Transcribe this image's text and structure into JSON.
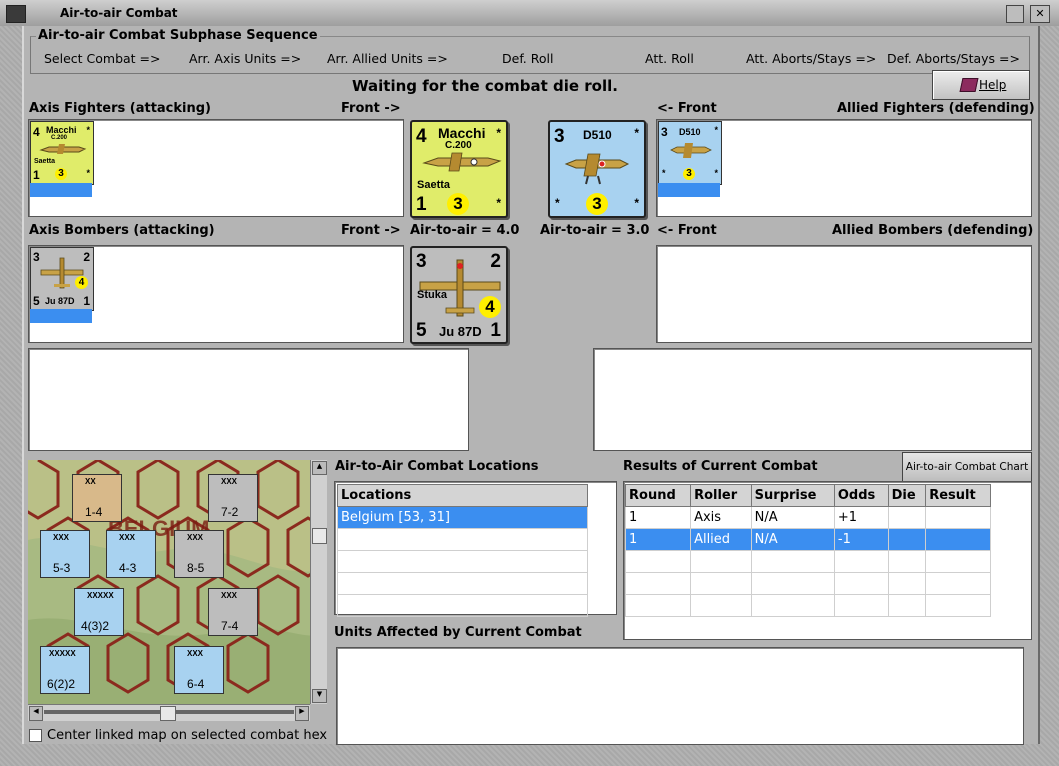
{
  "window": {
    "title": "Air-to-air Combat"
  },
  "sequence": {
    "title": "Air-to-air Combat Subphase Sequence",
    "steps": [
      "Select Combat =>",
      "Arr. Axis Units =>",
      "Arr. Allied Units =>",
      "Def. Roll",
      "Att. Roll",
      "Att. Aborts/Stays =>",
      "Def. Aborts/Stays =>"
    ]
  },
  "status": "Waiting for the combat die roll.",
  "help_label": "Help",
  "labels": {
    "axis_fighters": "Axis Fighters (attacking)",
    "front_right": "Front ->",
    "front_left": "<- Front",
    "allied_fighters": "Allied Fighters (defending)",
    "axis_bombers": "Axis Bombers (attacking)",
    "axis_a2a": "Air-to-air = 4.0",
    "allied_a2a": "Air-to-air = 3.0",
    "allied_bombers": "Allied Bombers (defending)"
  },
  "counters": {
    "macchi": {
      "att": "4",
      "name": "Macchi",
      "model": "C.200",
      "nick": "Saetta",
      "range": "1",
      "def": "3",
      "star": "*",
      "color": "#e0ec6a"
    },
    "d510": {
      "att": "3",
      "name": "D510",
      "range": "*",
      "def": "3",
      "star": "*",
      "color": "#a8d2f0"
    },
    "stuka": {
      "att": "3",
      "top": "2",
      "nick": "Stuka",
      "name": "Ju 87D",
      "range": "5",
      "def": "4",
      "bottom": "1",
      "color": "#bdbdbd"
    }
  },
  "locations": {
    "title": "Air-to-Air Combat Locations",
    "header": "Locations",
    "rows": [
      "Belgium [53, 31]"
    ]
  },
  "results": {
    "title": "Results of Current Combat",
    "chart_button": "Air-to-air Combat Chart",
    "headers": [
      "Round",
      "Roller",
      "Surprise",
      "Odds",
      "Die",
      "Result"
    ],
    "rows": [
      [
        "1",
        "Axis",
        "N/A",
        "+1",
        "",
        ""
      ],
      [
        "1",
        "Allied",
        "N/A",
        "-1",
        "",
        ""
      ]
    ]
  },
  "affected": {
    "title": "Units Affected by Current Combat"
  },
  "map": {
    "option_label": "Center linked map on selected combat hex",
    "counters": [
      {
        "top": "XX",
        "mid": "1-4",
        "color": "#d8b98a"
      },
      {
        "top": "XXX",
        "mid": "7-2",
        "color": "#bdbdbd"
      },
      {
        "top": "XXX",
        "mid": "5-3",
        "color": "#a8d2f0"
      },
      {
        "top": "XXX",
        "mid": "4-3",
        "color": "#a8d2f0"
      },
      {
        "top": "XXX",
        "mid": "8-5",
        "color": "#bdbdbd"
      },
      {
        "top": "XXXXX",
        "mid": "4(3)2",
        "color": "#a8d2f0"
      },
      {
        "top": "XXX",
        "mid": "7-4",
        "color": "#bdbdbd"
      },
      {
        "top": "XXXXX",
        "mid": "6(2)2",
        "color": "#a8d2f0"
      },
      {
        "top": "XXX",
        "mid": "6-4",
        "color": "#a8d2f0"
      }
    ]
  }
}
